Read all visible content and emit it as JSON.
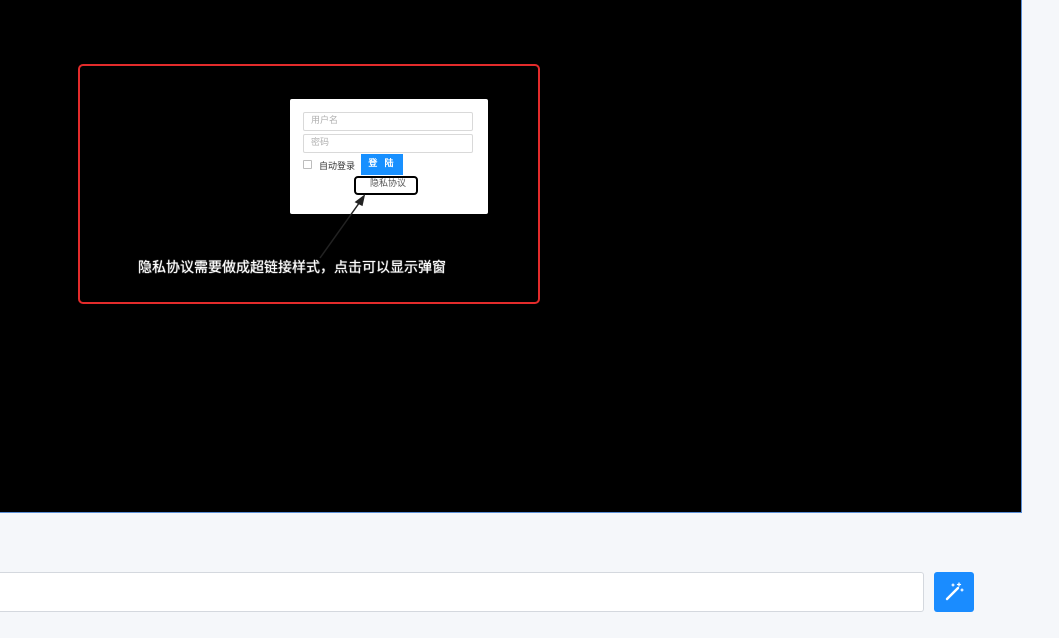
{
  "screenshot": {
    "login_form": {
      "username_placeholder": "用户名",
      "password_placeholder": "密码",
      "auto_login_label": "自动登录",
      "login_button_label": "登 陆",
      "privacy_link_label": "隐私协议"
    },
    "annotation": {
      "caption": "隐私协议需要做成超链接样式，点击可以显示弹窗",
      "frame_color": "#e32b2b"
    }
  },
  "prompt_bar": {
    "value": "",
    "expand_icon": "expand-arrows-icon",
    "submit_icon": "magic-wand-icon",
    "submit_color": "#1a8cff"
  }
}
